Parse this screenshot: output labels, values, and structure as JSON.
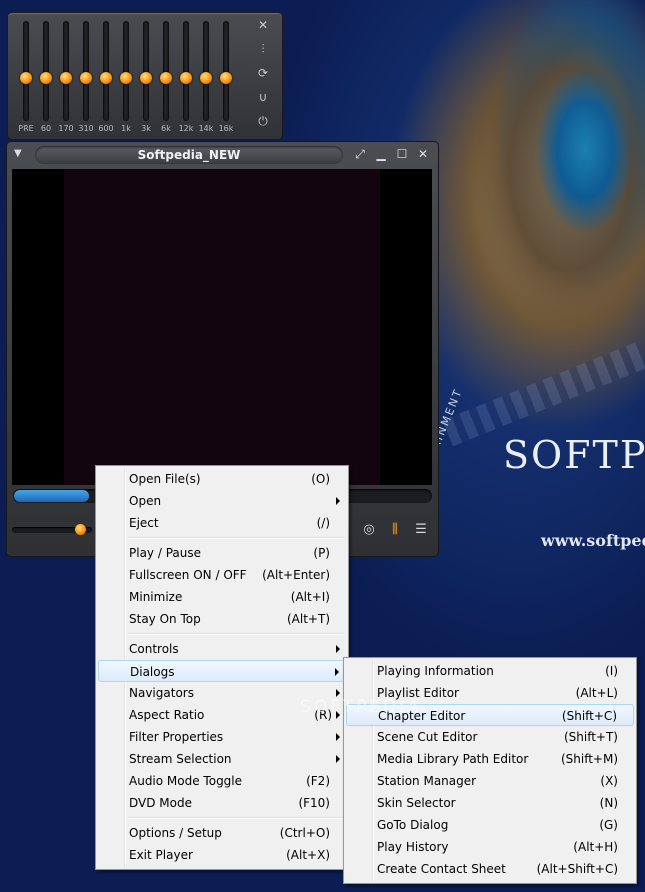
{
  "equalizer": {
    "bands": [
      "PRE",
      "60",
      "170",
      "310",
      "600",
      "1k",
      "3k",
      "6k",
      "12k",
      "14k",
      "16k"
    ],
    "side_buttons": [
      "close-icon",
      "sliders-icon",
      "repeat-icon",
      "magnet-icon",
      "power-icon"
    ]
  },
  "player": {
    "title": "Softpedia_NEW",
    "progress": 0.18,
    "volume": 0.85
  },
  "main_menu": {
    "items": [
      {
        "label": "Open File(s)",
        "shortcut": "(O)"
      },
      {
        "label": "Open",
        "shortcut": "",
        "submenu": true
      },
      {
        "label": "Eject",
        "shortcut": "(/)"
      },
      {
        "separator": true
      },
      {
        "label": "Play / Pause",
        "shortcut": "(P)"
      },
      {
        "label": "Fullscreen ON / OFF",
        "shortcut": "(Alt+Enter)"
      },
      {
        "label": "Minimize",
        "shortcut": "(Alt+I)"
      },
      {
        "label": "Stay On Top",
        "shortcut": "(Alt+T)"
      },
      {
        "separator": true
      },
      {
        "label": "Controls",
        "shortcut": "",
        "submenu": true
      },
      {
        "label": "Dialogs",
        "shortcut": "",
        "submenu": true,
        "highlighted": true
      },
      {
        "label": "Navigators",
        "shortcut": "",
        "submenu": true
      },
      {
        "label": "Aspect Ratio",
        "shortcut": "(R)",
        "submenu": true
      },
      {
        "label": "Filter Properties",
        "shortcut": "",
        "submenu": true
      },
      {
        "label": "Stream Selection",
        "shortcut": "",
        "submenu": true
      },
      {
        "label": "Audio Mode Toggle",
        "shortcut": "(F2)"
      },
      {
        "label": "DVD Mode",
        "shortcut": "(F10)"
      },
      {
        "separator": true
      },
      {
        "label": "Options / Setup",
        "shortcut": "(Ctrl+O)"
      },
      {
        "label": "Exit Player",
        "shortcut": "(Alt+X)"
      }
    ]
  },
  "dialogs_menu": {
    "items": [
      {
        "label": "Playing Information",
        "shortcut": "(I)"
      },
      {
        "label": "Playlist Editor",
        "shortcut": "(Alt+L)"
      },
      {
        "label": "Chapter Editor",
        "shortcut": "(Shift+C)",
        "highlighted": true
      },
      {
        "label": "Scene Cut Editor",
        "shortcut": "(Shift+T)"
      },
      {
        "label": "Media Library Path Editor",
        "shortcut": "(Shift+M)"
      },
      {
        "label": "Station Manager",
        "shortcut": "(X)"
      },
      {
        "label": "Skin Selector",
        "shortcut": "(N)"
      },
      {
        "label": "GoTo Dialog",
        "shortcut": "(G)"
      },
      {
        "label": "Play History",
        "shortcut": "(Alt+H)"
      },
      {
        "label": "Create Contact Sheet",
        "shortcut": "(Alt+Shift+C)"
      }
    ]
  },
  "desktop": {
    "brand": "SOFTPE",
    "brand_url": "www.softped",
    "tagline": "WEB ENTERTAINMENT",
    "watermark": "SOFTPEDIA"
  },
  "colors": {
    "accent_orange": "#ff9a10",
    "seek_blue": "#2a7fd0",
    "menu_bg": "#f0f0f0"
  }
}
